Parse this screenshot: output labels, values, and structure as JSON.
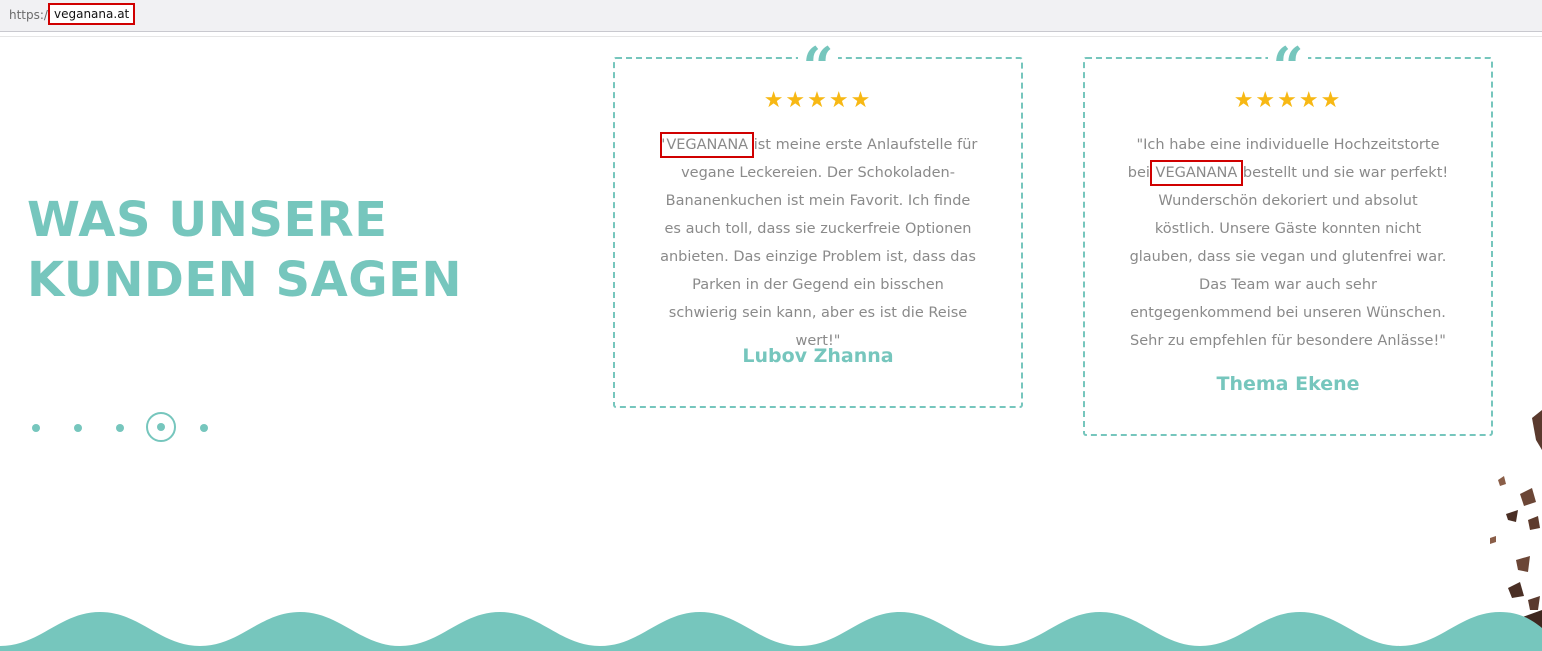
{
  "browser": {
    "url_scheme": "https:/",
    "url_host": "veganana.at"
  },
  "section": {
    "heading_line1": "WAS UNSERE",
    "heading_line2": "KUNDEN SAGEN"
  },
  "carousel": {
    "dot_count": 5,
    "active_index": 3
  },
  "testimonials": [
    {
      "rating": 5,
      "stars": "★★★★★",
      "quote_open": "\"",
      "brand": "VEGANANA",
      "text_after": " ist meine erste Anlaufstelle für vegane Leckereien. Der Schokoladen-Bananenkuchen ist mein Favorit. Ich finde es auch toll, dass sie zuckerfreie Optionen anbieten. Das einzige Problem ist, dass das Parken in der Gegend ein bisschen schwierig sein kann, aber es ist die Reise wert!\"",
      "author": "Lubov Zhanna"
    },
    {
      "rating": 5,
      "stars": "★★★★★",
      "quote_open": "\"Ich habe eine individuelle Hochzeitstorte bei ",
      "brand": "VEGANANA",
      "text_after": " bestellt und sie war perfekt! Wunderschön dekoriert und absolut köstlich. Unsere Gäste konnten nicht glauben, dass sie vegan und glutenfrei war. Das Team war auch sehr entgegenkommend bei unseren Wünschen. Sehr zu empfehlen für besondere Anlässe!\"",
      "author": "Thema Ekene"
    }
  ],
  "colors": {
    "accent": "#76c6bd",
    "star": "#f7b814",
    "body_text": "#8a8a8a",
    "highlight_box": "#d00000"
  },
  "icons": {
    "quote": "quote-icon",
    "star": "star-icon"
  }
}
